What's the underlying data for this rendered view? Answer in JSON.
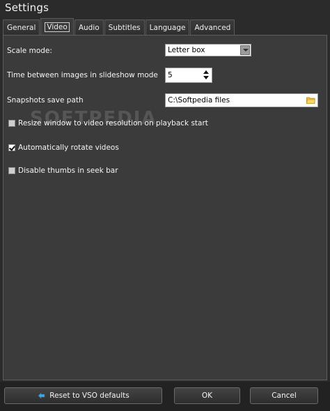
{
  "window": {
    "title": "Settings"
  },
  "tabs": [
    {
      "label": "General"
    },
    {
      "label": "Video",
      "active": true
    },
    {
      "label": "Audio"
    },
    {
      "label": "Subtitles"
    },
    {
      "label": "Language"
    },
    {
      "label": "Advanced"
    }
  ],
  "video": {
    "scale_mode_label": "Scale mode:",
    "scale_mode_value": "Letter box",
    "slideshow_label": "Time between images in slideshow mode",
    "slideshow_value": "5",
    "snapshot_label": "Snapshots save path",
    "snapshot_value": "C:\\Softpedia files",
    "checkboxes": [
      {
        "label": "Resize window to video resolution on playback start",
        "checked": false
      },
      {
        "label": "Automatically rotate videos",
        "checked": true
      },
      {
        "label": "Disable thumbs in seek bar",
        "checked": false
      }
    ]
  },
  "watermark": "SOFTPEDIA",
  "buttons": {
    "reset_label": "Reset to VSO defaults",
    "ok_label": "OK",
    "cancel_label": "Cancel"
  },
  "icons": {
    "dropdown": "chevron-down-icon",
    "spin_up": "arrow-up-icon",
    "spin_down": "arrow-down-icon",
    "folder": "folder-icon",
    "reset": "reset-icon"
  },
  "colors": {
    "background": "#2b2b2b",
    "panel": "#3b3b3b",
    "folder": "#f2c23a",
    "reset_icon": "#4aa3e0"
  }
}
